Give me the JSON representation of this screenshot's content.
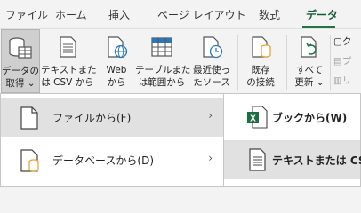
{
  "tabs": [
    "ファイル",
    "ホーム",
    "挿入",
    "ページ レイアウト",
    "数式",
    "データ"
  ],
  "ribbon": {
    "get_data": {
      "line1": "データの",
      "line2": "取得 ⌄"
    },
    "from_text_csv": {
      "line1": "テキストまた",
      "line2": "は CSV から"
    },
    "from_web": {
      "line1": "Web",
      "line2": "から"
    },
    "from_table": {
      "line1": "テーブルまた",
      "line2": "は範囲から"
    },
    "recent_sources": {
      "line1": "最近使っ",
      "line2": "たソース"
    },
    "existing_connections": {
      "line1": "既存",
      "line2": "の接続"
    },
    "refresh_all": {
      "line1": "すべて",
      "line2": "更新 ⌄"
    },
    "small_cmds": [
      "ク",
      "プ",
      "リ"
    ]
  },
  "menu_level1": [
    {
      "label": "ファイルから(F)",
      "arrow": "›"
    },
    {
      "label": "データベースから(D)",
      "arrow": "›"
    }
  ],
  "menu_level2": [
    {
      "label": "ブックから(W)"
    },
    {
      "label": "テキストまたは CSV"
    }
  ],
  "colors": {
    "accent": "#217346",
    "excel_green": "#1d6f42",
    "highlight": "#e1e1e1",
    "db_orange": "#e8a33d"
  }
}
